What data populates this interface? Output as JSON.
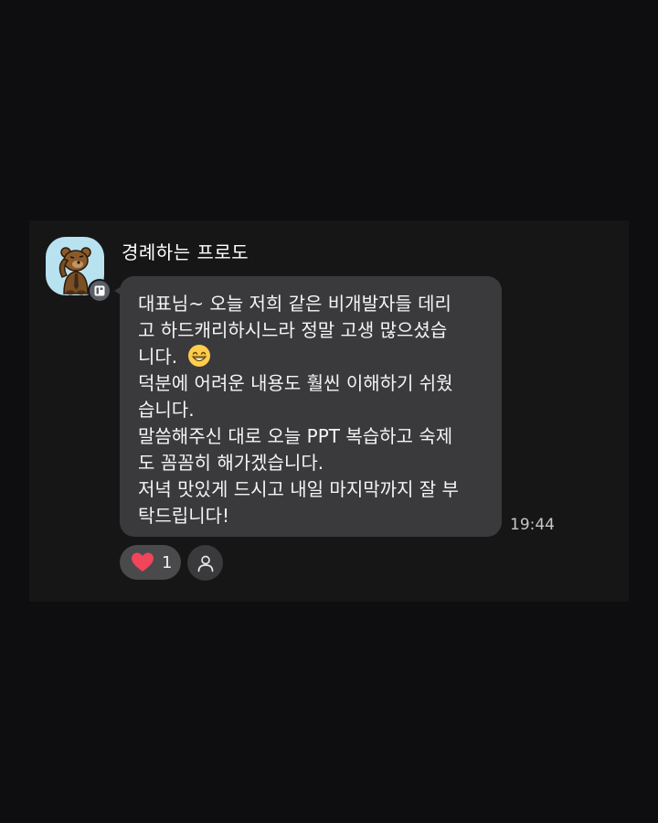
{
  "message": {
    "sender": "경례하는 프로도",
    "lines": [
      "대표님~ 오늘 저희 같은 비개발자들 데리",
      "고 하드캐리하시느라 정말 고생 많으셨습",
      "니다. ",
      "덕분에 어려운 내용도 훨씬 이해하기 쉬웠",
      "습니다.",
      "말씀해주신 대로 오늘 PPT 복습하고 숙제",
      "도 꼼꼼히 해가겠습니다.",
      "저녁 맛있게 드시고 내일 마지막까지 잘 부",
      "탁드립니다!"
    ],
    "emoji": "grinning-smile-emoji",
    "time": "19:44"
  },
  "reactions": {
    "heart_icon": "heart-icon",
    "heart_color": "#f0455a",
    "count": "1",
    "add_icon": "person-icon"
  },
  "avatar": {
    "icon": "saluting-frodo-avatar",
    "background": "#b9e2f0",
    "badge_icon": "profile-card-icon"
  },
  "colors": {
    "background": "#0e0e10",
    "panel": "#161617",
    "bubble": "#3a3a3c",
    "text": "#f5f5f5"
  }
}
